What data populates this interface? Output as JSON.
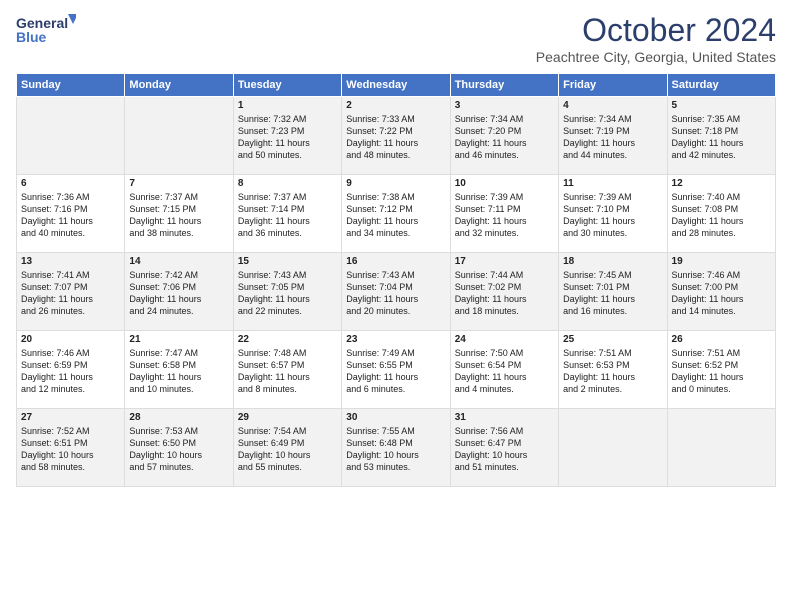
{
  "logo": {
    "line1": "General",
    "line2": "Blue"
  },
  "title": "October 2024",
  "subtitle": "Peachtree City, Georgia, United States",
  "headers": [
    "Sunday",
    "Monday",
    "Tuesday",
    "Wednesday",
    "Thursday",
    "Friday",
    "Saturday"
  ],
  "weeks": [
    [
      {
        "day": "",
        "lines": []
      },
      {
        "day": "",
        "lines": []
      },
      {
        "day": "1",
        "lines": [
          "Sunrise: 7:32 AM",
          "Sunset: 7:23 PM",
          "Daylight: 11 hours",
          "and 50 minutes."
        ]
      },
      {
        "day": "2",
        "lines": [
          "Sunrise: 7:33 AM",
          "Sunset: 7:22 PM",
          "Daylight: 11 hours",
          "and 48 minutes."
        ]
      },
      {
        "day": "3",
        "lines": [
          "Sunrise: 7:34 AM",
          "Sunset: 7:20 PM",
          "Daylight: 11 hours",
          "and 46 minutes."
        ]
      },
      {
        "day": "4",
        "lines": [
          "Sunrise: 7:34 AM",
          "Sunset: 7:19 PM",
          "Daylight: 11 hours",
          "and 44 minutes."
        ]
      },
      {
        "day": "5",
        "lines": [
          "Sunrise: 7:35 AM",
          "Sunset: 7:18 PM",
          "Daylight: 11 hours",
          "and 42 minutes."
        ]
      }
    ],
    [
      {
        "day": "6",
        "lines": [
          "Sunrise: 7:36 AM",
          "Sunset: 7:16 PM",
          "Daylight: 11 hours",
          "and 40 minutes."
        ]
      },
      {
        "day": "7",
        "lines": [
          "Sunrise: 7:37 AM",
          "Sunset: 7:15 PM",
          "Daylight: 11 hours",
          "and 38 minutes."
        ]
      },
      {
        "day": "8",
        "lines": [
          "Sunrise: 7:37 AM",
          "Sunset: 7:14 PM",
          "Daylight: 11 hours",
          "and 36 minutes."
        ]
      },
      {
        "day": "9",
        "lines": [
          "Sunrise: 7:38 AM",
          "Sunset: 7:12 PM",
          "Daylight: 11 hours",
          "and 34 minutes."
        ]
      },
      {
        "day": "10",
        "lines": [
          "Sunrise: 7:39 AM",
          "Sunset: 7:11 PM",
          "Daylight: 11 hours",
          "and 32 minutes."
        ]
      },
      {
        "day": "11",
        "lines": [
          "Sunrise: 7:39 AM",
          "Sunset: 7:10 PM",
          "Daylight: 11 hours",
          "and 30 minutes."
        ]
      },
      {
        "day": "12",
        "lines": [
          "Sunrise: 7:40 AM",
          "Sunset: 7:08 PM",
          "Daylight: 11 hours",
          "and 28 minutes."
        ]
      }
    ],
    [
      {
        "day": "13",
        "lines": [
          "Sunrise: 7:41 AM",
          "Sunset: 7:07 PM",
          "Daylight: 11 hours",
          "and 26 minutes."
        ]
      },
      {
        "day": "14",
        "lines": [
          "Sunrise: 7:42 AM",
          "Sunset: 7:06 PM",
          "Daylight: 11 hours",
          "and 24 minutes."
        ]
      },
      {
        "day": "15",
        "lines": [
          "Sunrise: 7:43 AM",
          "Sunset: 7:05 PM",
          "Daylight: 11 hours",
          "and 22 minutes."
        ]
      },
      {
        "day": "16",
        "lines": [
          "Sunrise: 7:43 AM",
          "Sunset: 7:04 PM",
          "Daylight: 11 hours",
          "and 20 minutes."
        ]
      },
      {
        "day": "17",
        "lines": [
          "Sunrise: 7:44 AM",
          "Sunset: 7:02 PM",
          "Daylight: 11 hours",
          "and 18 minutes."
        ]
      },
      {
        "day": "18",
        "lines": [
          "Sunrise: 7:45 AM",
          "Sunset: 7:01 PM",
          "Daylight: 11 hours",
          "and 16 minutes."
        ]
      },
      {
        "day": "19",
        "lines": [
          "Sunrise: 7:46 AM",
          "Sunset: 7:00 PM",
          "Daylight: 11 hours",
          "and 14 minutes."
        ]
      }
    ],
    [
      {
        "day": "20",
        "lines": [
          "Sunrise: 7:46 AM",
          "Sunset: 6:59 PM",
          "Daylight: 11 hours",
          "and 12 minutes."
        ]
      },
      {
        "day": "21",
        "lines": [
          "Sunrise: 7:47 AM",
          "Sunset: 6:58 PM",
          "Daylight: 11 hours",
          "and 10 minutes."
        ]
      },
      {
        "day": "22",
        "lines": [
          "Sunrise: 7:48 AM",
          "Sunset: 6:57 PM",
          "Daylight: 11 hours",
          "and 8 minutes."
        ]
      },
      {
        "day": "23",
        "lines": [
          "Sunrise: 7:49 AM",
          "Sunset: 6:55 PM",
          "Daylight: 11 hours",
          "and 6 minutes."
        ]
      },
      {
        "day": "24",
        "lines": [
          "Sunrise: 7:50 AM",
          "Sunset: 6:54 PM",
          "Daylight: 11 hours",
          "and 4 minutes."
        ]
      },
      {
        "day": "25",
        "lines": [
          "Sunrise: 7:51 AM",
          "Sunset: 6:53 PM",
          "Daylight: 11 hours",
          "and 2 minutes."
        ]
      },
      {
        "day": "26",
        "lines": [
          "Sunrise: 7:51 AM",
          "Sunset: 6:52 PM",
          "Daylight: 11 hours",
          "and 0 minutes."
        ]
      }
    ],
    [
      {
        "day": "27",
        "lines": [
          "Sunrise: 7:52 AM",
          "Sunset: 6:51 PM",
          "Daylight: 10 hours",
          "and 58 minutes."
        ]
      },
      {
        "day": "28",
        "lines": [
          "Sunrise: 7:53 AM",
          "Sunset: 6:50 PM",
          "Daylight: 10 hours",
          "and 57 minutes."
        ]
      },
      {
        "day": "29",
        "lines": [
          "Sunrise: 7:54 AM",
          "Sunset: 6:49 PM",
          "Daylight: 10 hours",
          "and 55 minutes."
        ]
      },
      {
        "day": "30",
        "lines": [
          "Sunrise: 7:55 AM",
          "Sunset: 6:48 PM",
          "Daylight: 10 hours",
          "and 53 minutes."
        ]
      },
      {
        "day": "31",
        "lines": [
          "Sunrise: 7:56 AM",
          "Sunset: 6:47 PM",
          "Daylight: 10 hours",
          "and 51 minutes."
        ]
      },
      {
        "day": "",
        "lines": []
      },
      {
        "day": "",
        "lines": []
      }
    ]
  ]
}
